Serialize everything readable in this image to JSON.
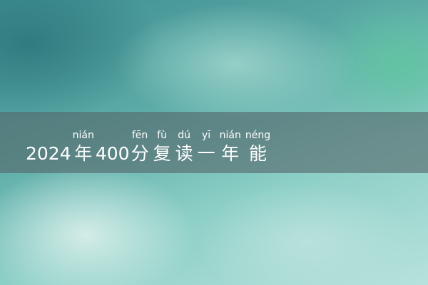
{
  "title": {
    "segments": [
      {
        "text": "2024",
        "pinyin": ""
      },
      {
        "text": "年",
        "pinyin": "nián"
      },
      {
        "text": "400",
        "pinyin": ""
      },
      {
        "text": "分",
        "pinyin": "fēn"
      },
      {
        "text": "复",
        "pinyin": "fù"
      },
      {
        "text": "读",
        "pinyin": "dú"
      },
      {
        "text": "一",
        "pinyin": "yī"
      },
      {
        "text": "年",
        "pinyin": "nián"
      },
      {
        "text": "能",
        "pinyin": "néng"
      }
    ]
  },
  "colors": {
    "band": "#56686a",
    "text": "#ffffff",
    "accent": "#60c4a0"
  }
}
